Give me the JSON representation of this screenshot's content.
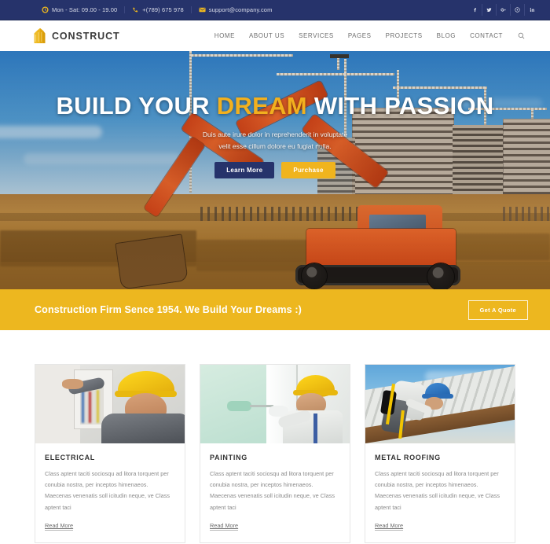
{
  "topbar": {
    "hours": {
      "icon": "clock-icon",
      "text": "Mon - Sat: 09.00 - 19.00"
    },
    "phone": {
      "icon": "phone-icon",
      "text": "+(789) 675 978"
    },
    "email": {
      "icon": "envelope-icon",
      "text": "support@company.com"
    },
    "social": [
      {
        "name": "facebook-icon",
        "glyph": "f"
      },
      {
        "name": "twitter-icon",
        "glyph": "t"
      },
      {
        "name": "google-plus-icon",
        "glyph": "G+"
      },
      {
        "name": "pinterest-icon",
        "glyph": "p"
      },
      {
        "name": "linkedin-icon",
        "glyph": "in"
      }
    ],
    "bg_color": "#26336b"
  },
  "header": {
    "logo_text": "CONSTRUCT",
    "logo_icon": "building-icon",
    "logo_color": "#edb71f",
    "nav": [
      {
        "label": "HOME"
      },
      {
        "label": "ABOUT US"
      },
      {
        "label": "SERVICES"
      },
      {
        "label": "PAGES"
      },
      {
        "label": "PROJECTS"
      },
      {
        "label": "BLOG"
      },
      {
        "label": "CONTACT"
      }
    ],
    "search_icon": "search-icon"
  },
  "hero": {
    "title_part1": "BUILD YOUR ",
    "title_highlight": "DREAM",
    "title_part2": " WITH PASSION",
    "highlight_color": "#f2b01e",
    "subtitle_line1": "Duis aute irure dolor in reprehenderit in voluptate",
    "subtitle_line2": "velit esse cillum dolore eu fugiat nulla.",
    "buttons": [
      {
        "label": "Learn More",
        "style": "dark",
        "color": "#26336b"
      },
      {
        "label": "Purchase",
        "style": "yellow",
        "color": "#f0b41e"
      }
    ],
    "image_description": "orange excavator digging at a construction site with tower cranes and concrete buildings"
  },
  "cta": {
    "text": "Construction Firm Sence 1954. We Build Your Dreams :)",
    "button_label": "Get A Quote",
    "bg_color": "#edb71f"
  },
  "services": {
    "cards": [
      {
        "title": "ELECTRICAL",
        "text": "Class aptent taciti sociosqu ad litora torquent per conubia nostra, per inceptos himenaeos. Maecenas venenatis soll icitudin neque, ve Class aptent taci",
        "link": "Read More",
        "image_description": "smiling electrician in yellow hard hat working on wiring panel"
      },
      {
        "title": "PAINTING",
        "text": "Class aptent taciti sociosqu ad litora torquent per conubia nostra, per inceptos himenaeos. Maecenas venenatis soll icitudin neque, ve Class aptent taci",
        "link": "Read More",
        "image_description": "painter in yellow hard hat rolling mint green paint on a wall"
      },
      {
        "title": "METAL ROOFING",
        "text": "Class aptent taciti sociosqu ad litora torquent per conubia nostra, per inceptos himenaeos. Maecenas venenatis soll icitudin neque, ve Class aptent taci",
        "link": "Read More",
        "image_description": "roofer in blue hard hat with safety harness working on a metal roof"
      }
    ]
  }
}
